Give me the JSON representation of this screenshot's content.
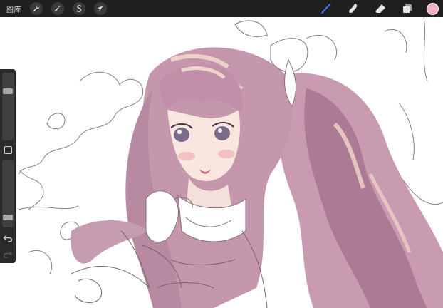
{
  "topbar": {
    "gallery_label": "图库",
    "left_tools": [
      {
        "name": "actions",
        "icon": "wrench-icon"
      },
      {
        "name": "adjustments",
        "icon": "magic-wand-icon"
      },
      {
        "name": "selection",
        "icon": "selection-s-icon"
      },
      {
        "name": "transform",
        "icon": "arrow-cursor-icon"
      }
    ],
    "right_tools": [
      {
        "name": "brush",
        "icon": "brush-icon",
        "active": true
      },
      {
        "name": "smudge",
        "icon": "smudge-icon"
      },
      {
        "name": "eraser",
        "icon": "eraser-icon"
      },
      {
        "name": "layers",
        "icon": "layers-icon"
      }
    ],
    "current_color": "#f4b3c0",
    "active_tool_color": "#3d7bff"
  },
  "sidebar": {
    "brush_size_level": 0.75,
    "brush_opacity_level": 0.12,
    "buttons": [
      "modify-square-icon",
      "undo-icon",
      "redo-icon"
    ]
  },
  "canvas": {
    "background": "#ffffff",
    "subject": "anime-girl-illustration",
    "palette": {
      "hair": "#c08fa6",
      "hair_shadow": "#9c6a86",
      "hair_light": "#f0cfc2",
      "skin": "#f7e4de",
      "blush": "#f2b3b8",
      "line": "#6b4a55"
    }
  }
}
